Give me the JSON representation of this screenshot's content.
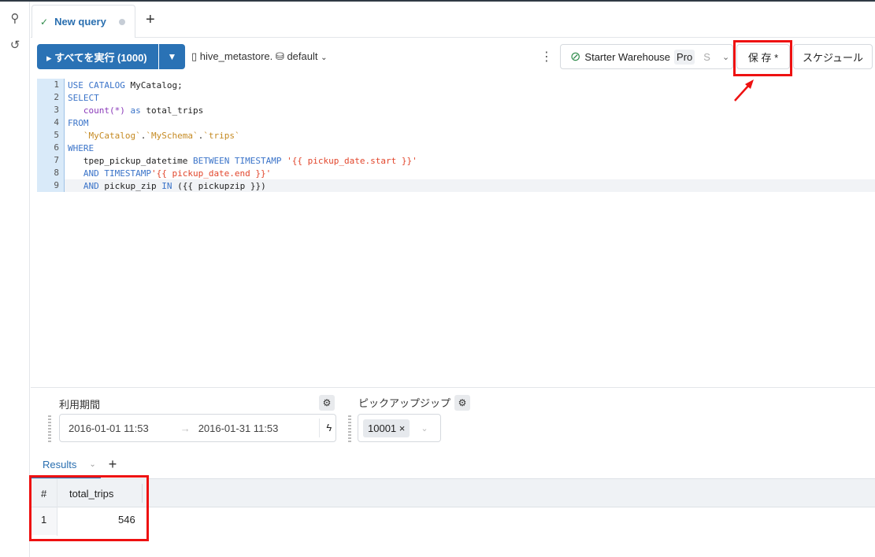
{
  "sidebar": {
    "items": [
      {
        "icon": "shapes-icon"
      },
      {
        "icon": "history-icon"
      }
    ]
  },
  "tabs": [
    {
      "label": "New query",
      "status": "saved-check"
    }
  ],
  "toolbar": {
    "run_label": "▸ すべてを実行 (1000)",
    "catalog": "hive_metastore.",
    "schema": "default",
    "warehouse": "Starter Warehouse",
    "warehouse_tier": "Pro",
    "warehouse_size": "S",
    "save_label": "保 存 *",
    "schedule_label": "スケジュール"
  },
  "editor": {
    "lines": [
      [
        [
          "kw",
          "USE CATALOG "
        ],
        [
          "id",
          "MyCatalog;"
        ]
      ],
      [
        [
          "kw",
          "SELECT"
        ]
      ],
      [
        [
          "id",
          "   "
        ],
        [
          "fn",
          "count(*)"
        ],
        [
          "kw",
          " as "
        ],
        [
          "id",
          "total_trips"
        ]
      ],
      [
        [
          "kw",
          "FROM"
        ]
      ],
      [
        [
          "id",
          "   "
        ],
        [
          "str",
          "`MyCatalog`"
        ],
        [
          "id",
          "."
        ],
        [
          "str",
          "`MySchema`"
        ],
        [
          "id",
          "."
        ],
        [
          "str",
          "`trips`"
        ]
      ],
      [
        [
          "kw",
          "WHERE"
        ]
      ],
      [
        [
          "id",
          "   tpep_pickup_datetime "
        ],
        [
          "kw",
          "BETWEEN TIMESTAMP "
        ],
        [
          "tpl",
          "'{{ pickup_date.start }}'"
        ]
      ],
      [
        [
          "id",
          "   "
        ],
        [
          "kw",
          "AND TIMESTAMP"
        ],
        [
          "tpl",
          "'{{ pickup_date.end }}'"
        ]
      ],
      [
        [
          "id",
          "   "
        ],
        [
          "kw",
          "AND "
        ],
        [
          "id",
          "pickup_zip "
        ],
        [
          "kw",
          "IN "
        ],
        [
          "id",
          "({{ pickupzip }})"
        ]
      ]
    ]
  },
  "params": {
    "date": {
      "label": "利用期間",
      "start": "2016-01-01 11:53",
      "end": "2016-01-31 11:53"
    },
    "zip": {
      "label": "ピックアップジップ",
      "value": "10001"
    }
  },
  "results": {
    "tab_label": "Results",
    "columns": [
      "#",
      "total_trips"
    ],
    "rows": [
      [
        "1",
        "546"
      ]
    ]
  },
  "colors": {
    "accent": "#2a72b5",
    "highlight": "#ee1111"
  }
}
